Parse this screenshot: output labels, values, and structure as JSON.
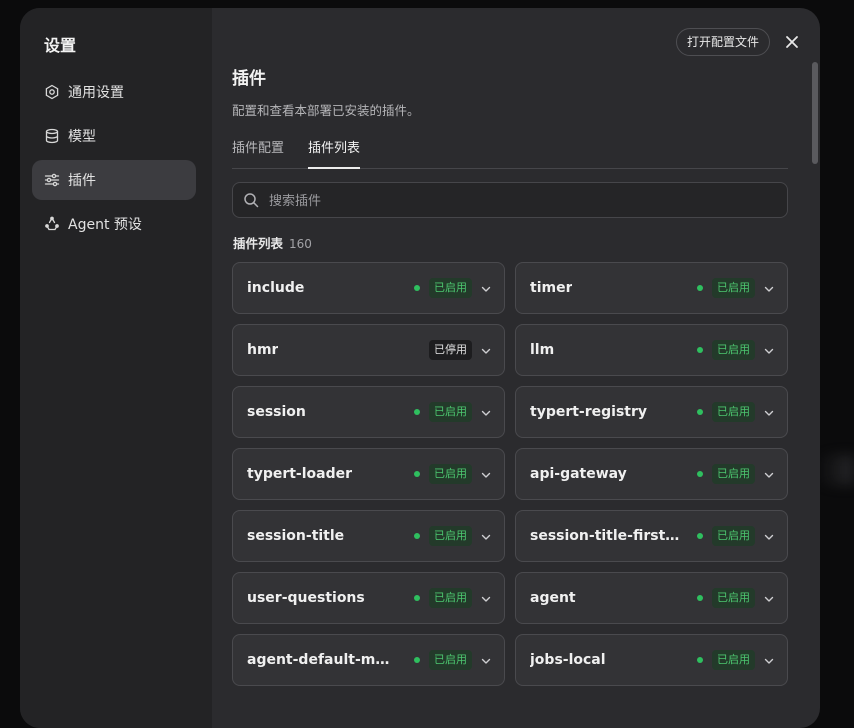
{
  "dialog": {
    "title": "设置"
  },
  "sidebar": {
    "items": [
      {
        "label": "通用设置",
        "icon": "gear-icon",
        "active": false
      },
      {
        "label": "模型",
        "icon": "database-icon",
        "active": false
      },
      {
        "label": "插件",
        "icon": "sliders-icon",
        "active": true
      },
      {
        "label": "Agent 预设",
        "icon": "agent-icon",
        "active": false
      }
    ]
  },
  "header": {
    "open_config_label": "打开配置文件",
    "close_icon": "close-icon"
  },
  "main": {
    "title": "插件",
    "description": "配置和查看本部署已安装的插件。",
    "tabs": [
      {
        "label": "插件配置",
        "active": false
      },
      {
        "label": "插件列表",
        "active": true
      }
    ],
    "search": {
      "placeholder": "搜索插件",
      "value": ""
    },
    "list_label": "插件列表",
    "list_count": "160",
    "plugins": [
      {
        "name": "include",
        "status": "已启用",
        "enabled": true
      },
      {
        "name": "timer",
        "status": "已启用",
        "enabled": true
      },
      {
        "name": "hmr",
        "status": "已停用",
        "enabled": false
      },
      {
        "name": "llm",
        "status": "已启用",
        "enabled": true
      },
      {
        "name": "session",
        "status": "已启用",
        "enabled": true
      },
      {
        "name": "typert-registry",
        "status": "已启用",
        "enabled": true
      },
      {
        "name": "typert-loader",
        "status": "已启用",
        "enabled": true
      },
      {
        "name": "api-gateway",
        "status": "已启用",
        "enabled": true
      },
      {
        "name": "session-title",
        "status": "已启用",
        "enabled": true
      },
      {
        "name": "session-title-first-pr...",
        "status": "已启用",
        "enabled": true
      },
      {
        "name": "user-questions",
        "status": "已启用",
        "enabled": true
      },
      {
        "name": "agent",
        "status": "已启用",
        "enabled": true
      },
      {
        "name": "agent-default-model",
        "status": "已启用",
        "enabled": true
      },
      {
        "name": "jobs-local",
        "status": "已启用",
        "enabled": true
      }
    ]
  },
  "colors": {
    "dialog_bg": "#2b2b2e",
    "sidebar_bg": "#232325",
    "card_bg": "#333336",
    "enabled_green": "#4cc66f",
    "enabled_dot": "#2fbf5f"
  }
}
